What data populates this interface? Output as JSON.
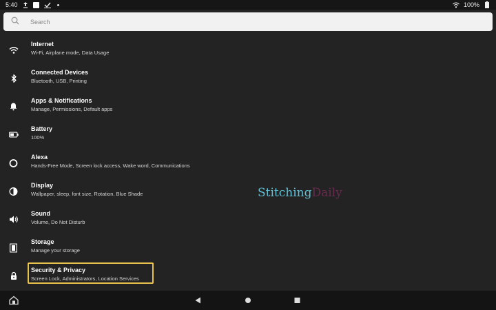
{
  "status_bar": {
    "time": "5:40",
    "icons": [
      "upload-icon",
      "notification-square-icon",
      "checkmark-icon",
      "dot-icon"
    ],
    "battery_text": "100%"
  },
  "search": {
    "placeholder": "Search"
  },
  "settings": [
    {
      "icon": "wifi-icon",
      "title": "Internet",
      "subtitle": "Wi-Fi, Airplane mode, Data Usage"
    },
    {
      "icon": "bluetooth-icon",
      "title": "Connected Devices",
      "subtitle": "Bluetooth, USB, Printing"
    },
    {
      "icon": "bell-icon",
      "title": "Apps & Notifications",
      "subtitle": "Manage, Permissions, Default apps"
    },
    {
      "icon": "battery-icon",
      "title": "Battery",
      "subtitle": "100%"
    },
    {
      "icon": "alexa-icon",
      "title": "Alexa",
      "subtitle": "Hands-Free Mode, Screen lock access, Wake word, Communications"
    },
    {
      "icon": "display-icon",
      "title": "Display",
      "subtitle": "Wallpaper, sleep, font size, Rotation, Blue Shade"
    },
    {
      "icon": "speaker-icon",
      "title": "Sound",
      "subtitle": "Volume, Do Not Disturb"
    },
    {
      "icon": "storage-icon",
      "title": "Storage",
      "subtitle": "Manage your storage"
    },
    {
      "icon": "lock-icon",
      "title": "Security & Privacy",
      "subtitle": "Screen Lock, Administrators, Location Services"
    }
  ],
  "highlighted_item": "Security & Privacy",
  "accent_color": "#e9c24d",
  "watermark": {
    "part1": "Stitching",
    "part2": "Daily"
  },
  "nav_bar": {
    "icons": [
      "home-icon",
      "back-icon",
      "home-circle-icon",
      "recents-icon"
    ]
  }
}
